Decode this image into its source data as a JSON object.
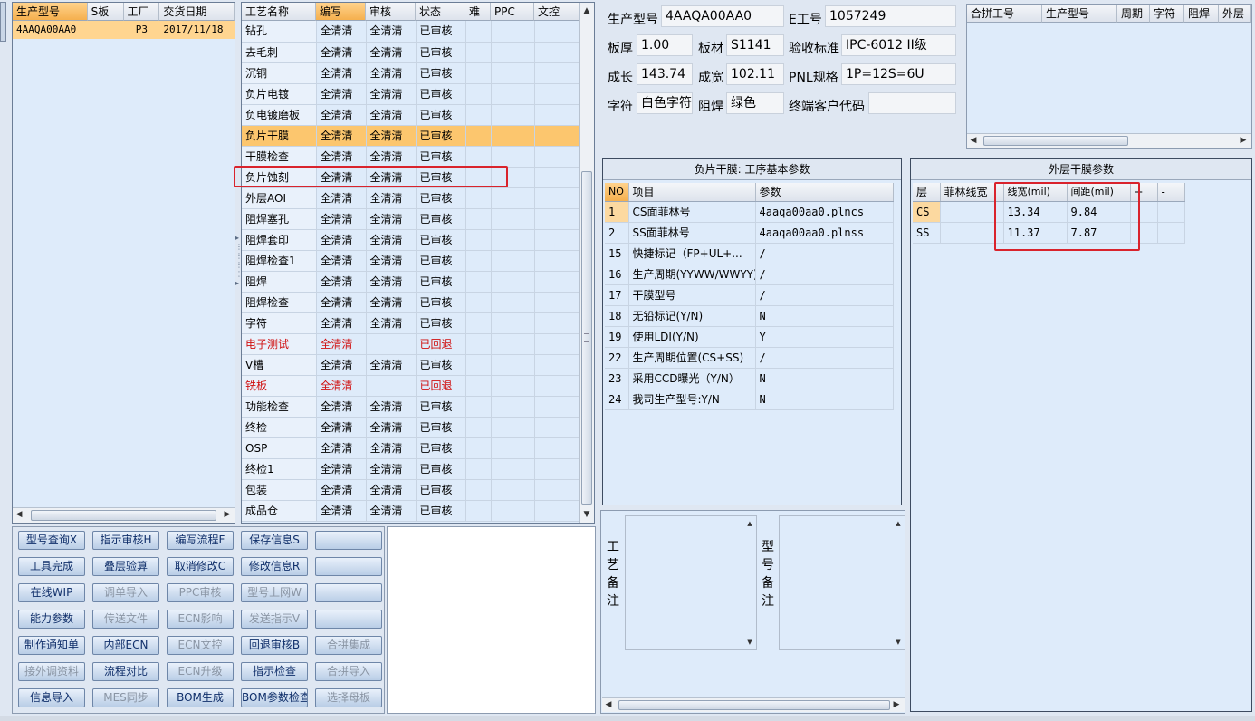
{
  "left_grid": {
    "headers": [
      "生产型号",
      "S板",
      "工厂",
      "交货日期"
    ],
    "rows": [
      {
        "model": "4AAQA00AA0",
        "s": "",
        "factory": "P3",
        "date": "2017/11/18"
      }
    ]
  },
  "process_grid": {
    "headers": [
      "工艺名称",
      "编写",
      "审核",
      "状态",
      "难",
      "PPC",
      "文控"
    ],
    "rows": [
      {
        "name": "钻孔",
        "write": "全清清",
        "review": "全清清",
        "status": "已审核"
      },
      {
        "name": "去毛刺",
        "write": "全清清",
        "review": "全清清",
        "status": "已审核"
      },
      {
        "name": "沉铜",
        "write": "全清清",
        "review": "全清清",
        "status": "已审核"
      },
      {
        "name": "负片电镀",
        "write": "全清清",
        "review": "全清清",
        "status": "已审核"
      },
      {
        "name": "负电镀磨板",
        "write": "全清清",
        "review": "全清清",
        "status": "已审核"
      },
      {
        "name": "负片干膜",
        "write": "全清清",
        "review": "全清清",
        "status": "已审核"
      },
      {
        "name": "干膜检查",
        "write": "全清清",
        "review": "全清清",
        "status": "已审核"
      },
      {
        "name": "负片蚀刻",
        "write": "全清清",
        "review": "全清清",
        "status": "已审核"
      },
      {
        "name": "外层AOI",
        "write": "全清清",
        "review": "全清清",
        "status": "已审核"
      },
      {
        "name": "阻焊塞孔",
        "write": "全清清",
        "review": "全清清",
        "status": "已审核"
      },
      {
        "name": "阻焊套印",
        "write": "全清清",
        "review": "全清清",
        "status": "已审核"
      },
      {
        "name": "阻焊检查1",
        "write": "全清清",
        "review": "全清清",
        "status": "已审核"
      },
      {
        "name": "阻焊",
        "write": "全清清",
        "review": "全清清",
        "status": "已审核"
      },
      {
        "name": "阻焊检查",
        "write": "全清清",
        "review": "全清清",
        "status": "已审核"
      },
      {
        "name": "字符",
        "write": "全清清",
        "review": "全清清",
        "status": "已审核"
      },
      {
        "name": "电子测试",
        "write": "全清清",
        "review": "",
        "status": "已回退"
      },
      {
        "name": "V槽",
        "write": "全清清",
        "review": "全清清",
        "status": "已审核"
      },
      {
        "name": "铣板",
        "write": "全清清",
        "review": "",
        "status": "已回退"
      },
      {
        "name": "功能检查",
        "write": "全清清",
        "review": "全清清",
        "status": "已审核"
      },
      {
        "name": "终检",
        "write": "全清清",
        "review": "全清清",
        "status": "已审核"
      },
      {
        "name": "OSP",
        "write": "全清清",
        "review": "全清清",
        "status": "已审核"
      },
      {
        "name": "终检1",
        "write": "全清清",
        "review": "全清清",
        "status": "已审核"
      },
      {
        "name": "包装",
        "write": "全清清",
        "review": "全清清",
        "status": "已审核"
      },
      {
        "name": "成品仓",
        "write": "全清清",
        "review": "全清清",
        "status": "已审核"
      }
    ],
    "selected_index": 5,
    "returned_status": "已回退"
  },
  "buttons": [
    [
      "型号查询X",
      "指示审核H",
      "编写流程F",
      "保存信息S",
      ""
    ],
    [
      "工具完成",
      "叠层验算",
      "取消修改C",
      "修改信息R",
      ""
    ],
    [
      "在线WIP",
      "调单导入",
      "PPC审核",
      "型号上网W",
      ""
    ],
    [
      "能力参数",
      "传送文件",
      "ECN影响",
      "发送指示V",
      ""
    ],
    [
      "制作通知单",
      "内部ECN",
      "ECN文控",
      "回退审核B",
      "合拼集成"
    ],
    [
      "接外调资料",
      "流程对比",
      "ECN升级",
      "指示检查",
      "合拼导入"
    ],
    [
      "信息导入",
      "MES同步",
      "BOM生成",
      "BOM参数检查",
      "选择母板"
    ]
  ],
  "info": {
    "model_label": "生产型号",
    "model_value": "4AAQA00AA0",
    "eno_label": "E工号",
    "eno_value": "1057249",
    "thick_label": "板厚",
    "thick_value": "1.00",
    "material_label": "板材",
    "material_value": "S1141",
    "standard_label": "验收标准",
    "standard_value": "IPC-6012 II级",
    "len_label": "成长",
    "len_value": "143.74",
    "width_label": "成宽",
    "width_value": "102.11",
    "pnl_label": "PNL规格",
    "pnl_value": "1P=12S=6U",
    "char_label": "字符",
    "char_value": "白色字符",
    "mask_label": "阻焊",
    "mask_value": "绿色",
    "customer_label": "终端客户代码",
    "customer_value": ""
  },
  "merge_grid": {
    "headers": [
      "合拼工号",
      "生产型号",
      "周期",
      "字符",
      "阻焊",
      "外层"
    ]
  },
  "params": {
    "title": "负片干膜: 工序基本参数",
    "headers": [
      "NO",
      "项目",
      "参数"
    ],
    "rows": [
      {
        "no": "1",
        "item": "CS面菲林号",
        "value": "4aaqa00aa0.plncs"
      },
      {
        "no": "2",
        "item": "SS面菲林号",
        "value": "4aaqa00aa0.plnss"
      },
      {
        "no": "15",
        "item": "快捷标记（FP+UL+...",
        "value": "/"
      },
      {
        "no": "16",
        "item": "生产周期(YYWW/WWYY)",
        "value": "/"
      },
      {
        "no": "17",
        "item": "干膜型号",
        "value": "/"
      },
      {
        "no": "18",
        "item": "无铅标记(Y/N)",
        "value": "N"
      },
      {
        "no": "19",
        "item": "使用LDI(Y/N)",
        "value": "Y"
      },
      {
        "no": "22",
        "item": "生产周期位置(CS+SS)",
        "value": "/"
      },
      {
        "no": "23",
        "item": "采用CCD曝光（Y/N）",
        "value": "N"
      },
      {
        "no": "24",
        "item": "我司生产型号:Y/N",
        "value": "N"
      }
    ]
  },
  "outer": {
    "title": "外层干膜参数",
    "headers": [
      "层",
      "菲林线宽",
      "线宽(mil)",
      "间距(mil)",
      "+",
      "-"
    ],
    "rows": [
      {
        "layer": "CS",
        "film": "",
        "width": "13.34",
        "gap": "9.84"
      },
      {
        "layer": "SS",
        "film": "",
        "width": "11.37",
        "gap": "7.87"
      }
    ]
  },
  "remarks": {
    "process_label": [
      "工",
      "艺",
      "备",
      "注"
    ],
    "model_label": [
      "型",
      "号",
      "备",
      "注"
    ]
  }
}
